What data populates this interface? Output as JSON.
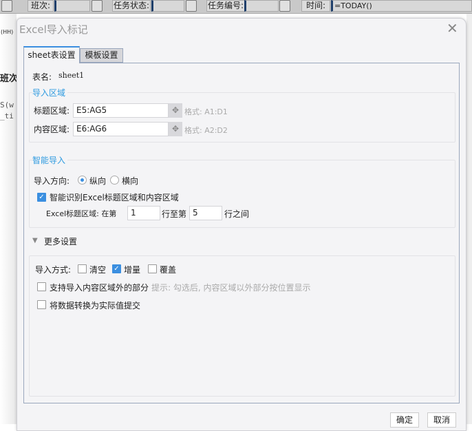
{
  "toolbar": {
    "shift_label": "班次:",
    "task_status_label": "任务状态:",
    "task_no_label": "任务编号:",
    "time_label": "时间:",
    "time_value": "=TODAY()"
  },
  "background": {
    "header_text": "班次",
    "unit_text": "(HH)",
    "formula_line1": "S(w",
    "formula_line2": "_ti"
  },
  "dialog": {
    "title": "Excel导入标记",
    "tabs": [
      {
        "label": "sheet表设置",
        "active": true
      },
      {
        "label": "模板设置",
        "active": false
      }
    ],
    "sheet_name_label": "表名:",
    "sheet_name": "sheet1",
    "import_area": {
      "title": "导入区域",
      "header_label": "标题区域:",
      "header_value": "E5:AG5",
      "header_hint": "格式: A1:D1",
      "content_label": "内容区域:",
      "content_value": "E6:AG6",
      "content_hint": "格式: A2:D2"
    },
    "smart_import": {
      "title": "智能导入",
      "direction_label": "导入方向:",
      "direction_options": [
        "纵向",
        "横向"
      ],
      "direction_selected": "纵向",
      "auto_detect_label": "智能识别Excel标题区域和内容区域",
      "auto_detect_checked": true,
      "header_rows_label": "Excel标题区域: 在第",
      "row_from": "1",
      "row_to_label": "行至第",
      "row_to": "5",
      "row_end_label": "行之间"
    },
    "more_settings": {
      "title": "更多设置",
      "mode_label": "导入方式:",
      "modes": [
        {
          "label": "清空",
          "checked": false
        },
        {
          "label": "增量",
          "checked": true
        },
        {
          "label": "覆盖",
          "checked": false
        }
      ],
      "outside_label": "支持导入内容区域外的部分",
      "outside_checked": false,
      "outside_hint": "提示: 勾选后, 内容区域以外部分按位置显示",
      "convert_label": "将数据转换为实际值提交",
      "convert_checked": false
    },
    "ok_label": "确定",
    "cancel_label": "取消"
  },
  "colors": {
    "accent": "#3b8fe0",
    "section_title": "#2f9be0"
  }
}
